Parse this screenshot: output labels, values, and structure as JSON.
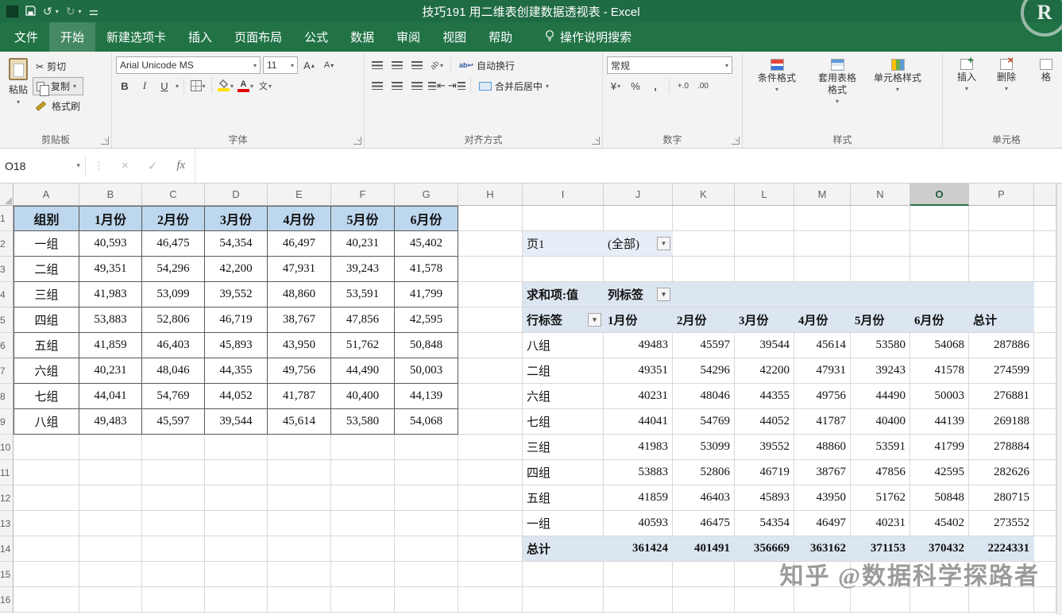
{
  "titlebar": {
    "title": "技巧191 用二维表创建数据透视表 - Excel"
  },
  "tabs": {
    "items": [
      "文件",
      "开始",
      "新建选项卡",
      "插入",
      "页面布局",
      "公式",
      "数据",
      "审阅",
      "视图",
      "帮助"
    ],
    "active": "开始",
    "search_label": "操作说明搜索"
  },
  "ribbon": {
    "clipboard": {
      "group": "剪贴板",
      "paste": "粘贴",
      "cut": "剪切",
      "copy": "复制",
      "format_painter": "格式刷"
    },
    "font": {
      "group": "字体",
      "font_name": "Arial Unicode MS",
      "font_size": "11",
      "bold": "B",
      "italic": "I",
      "underline": "U",
      "phonetic": "文"
    },
    "alignment": {
      "group": "对齐方式",
      "wrap": "自动换行",
      "merge": "合并后居中"
    },
    "number": {
      "group": "数字",
      "format": "常规",
      "currency": "¥",
      "percent": "%",
      "comma": ",",
      "inc_decimal": "+.0",
      "dec_decimal": ".00"
    },
    "styles": {
      "group": "样式",
      "conditional": "条件格式",
      "table_format": "套用表格格式",
      "cell_styles": "单元格样式"
    },
    "cells": {
      "group": "单元格",
      "insert": "插入",
      "delete": "删除",
      "format": "格"
    }
  },
  "formula_bar": {
    "name_box": "O18"
  },
  "sheet": {
    "col_headers": [
      "A",
      "B",
      "C",
      "D",
      "E",
      "F",
      "G",
      "H",
      "I",
      "J",
      "K",
      "L",
      "M",
      "N",
      "O",
      "P"
    ],
    "selected_col": "O",
    "row_count": 16,
    "source_table": {
      "headers": [
        "组别",
        "1月份",
        "2月份",
        "3月份",
        "4月份",
        "5月份",
        "6月份"
      ],
      "rows": [
        [
          "一组",
          "40,593",
          "46,475",
          "54,354",
          "46,497",
          "40,231",
          "45,402"
        ],
        [
          "二组",
          "49,351",
          "54,296",
          "42,200",
          "47,931",
          "39,243",
          "41,578"
        ],
        [
          "三组",
          "41,983",
          "53,099",
          "39,552",
          "48,860",
          "53,591",
          "41,799"
        ],
        [
          "四组",
          "53,883",
          "52,806",
          "46,719",
          "38,767",
          "47,856",
          "42,595"
        ],
        [
          "五组",
          "41,859",
          "46,403",
          "45,893",
          "43,950",
          "51,762",
          "50,848"
        ],
        [
          "六组",
          "40,231",
          "48,046",
          "44,355",
          "49,756",
          "44,490",
          "50,003"
        ],
        [
          "七组",
          "44,041",
          "54,769",
          "44,052",
          "41,787",
          "40,400",
          "44,139"
        ],
        [
          "八组",
          "49,483",
          "45,597",
          "39,544",
          "45,614",
          "53,580",
          "54,068"
        ]
      ]
    },
    "pivot": {
      "filter_label": "页1",
      "filter_value": "(全部)",
      "value_label": "求和项:值",
      "col_label": "列标签",
      "row_label": "行标签",
      "columns": [
        "1月份",
        "2月份",
        "3月份",
        "4月份",
        "5月份",
        "6月份",
        "总计"
      ],
      "rows": [
        [
          "八组",
          49483,
          45597,
          39544,
          45614,
          53580,
          54068,
          287886
        ],
        [
          "二组",
          49351,
          54296,
          42200,
          47931,
          39243,
          41578,
          274599
        ],
        [
          "六组",
          40231,
          48046,
          44355,
          49756,
          44490,
          50003,
          276881
        ],
        [
          "七组",
          44041,
          54769,
          44052,
          41787,
          40400,
          44139,
          269188
        ],
        [
          "三组",
          41983,
          53099,
          39552,
          48860,
          53591,
          41799,
          278884
        ],
        [
          "四组",
          53883,
          52806,
          46719,
          38767,
          47856,
          42595,
          282626
        ],
        [
          "五组",
          41859,
          46403,
          45893,
          43950,
          51762,
          50848,
          280715
        ],
        [
          "一组",
          40593,
          46475,
          54354,
          46497,
          40231,
          45402,
          273552
        ]
      ],
      "total": [
        "总计",
        361424,
        401491,
        356669,
        363162,
        371153,
        370432,
        2224331
      ]
    }
  },
  "watermark": "知乎 @数据科学探路者",
  "logo_letter": "R"
}
